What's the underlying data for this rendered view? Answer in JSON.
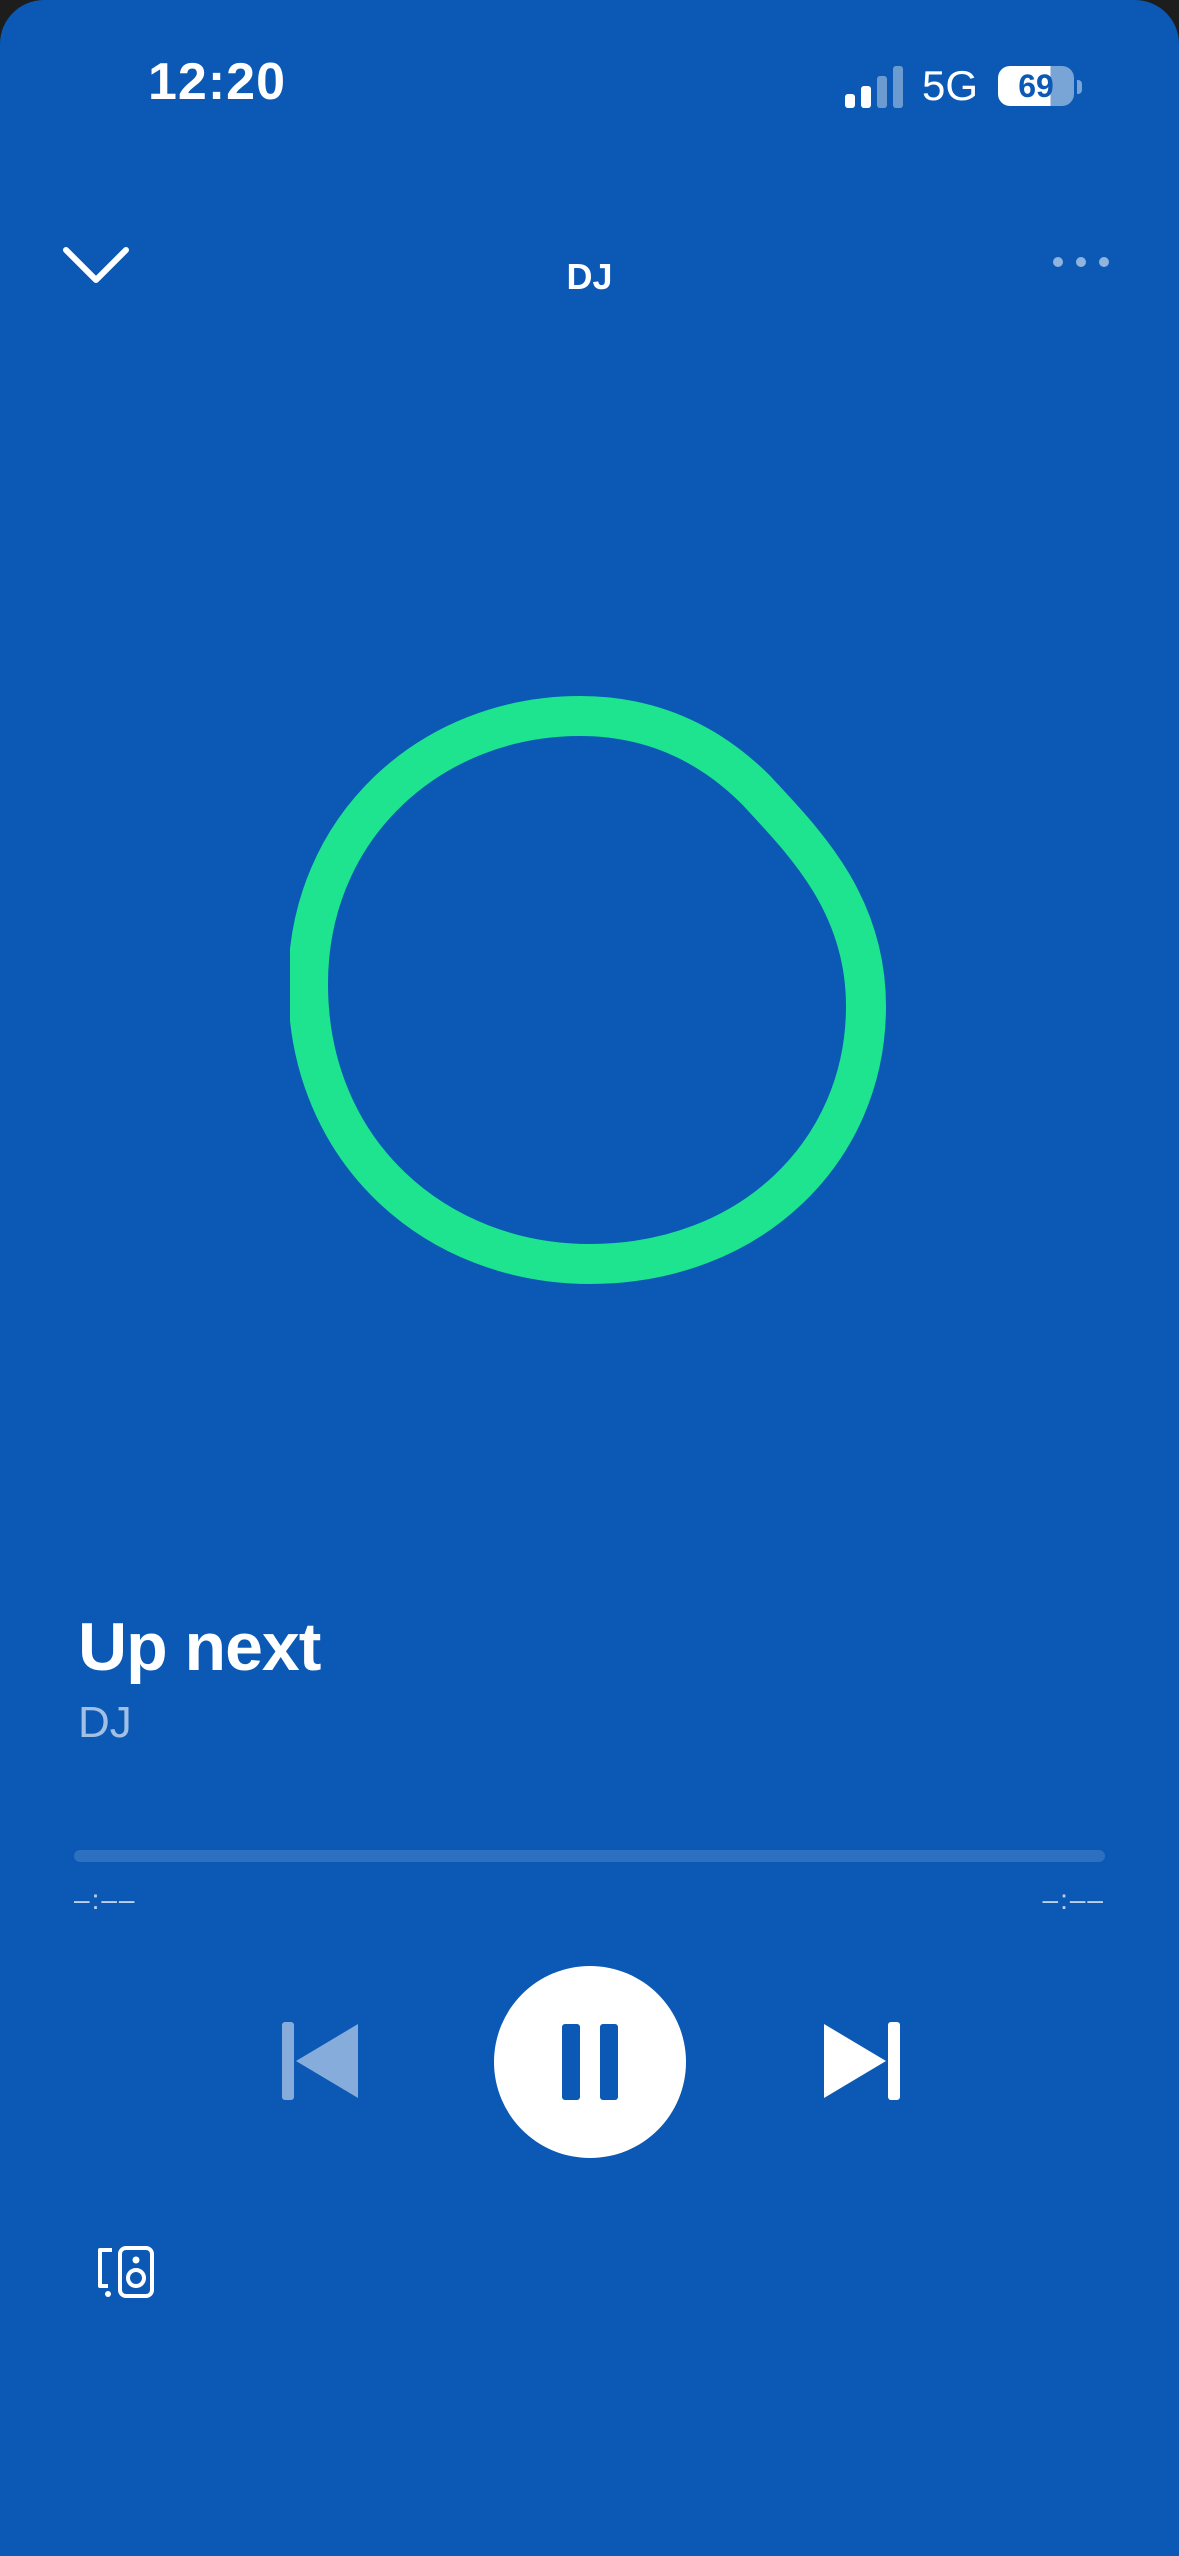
{
  "status_bar": {
    "time": "12:20",
    "network": "5G",
    "battery_level": "69",
    "signal_icon": "cellular-signal-icon"
  },
  "header": {
    "title": "DJ",
    "collapse_icon": "chevron-down-icon",
    "more_icon": "more-options-icon"
  },
  "artwork": {
    "icon": "dj-ring-icon",
    "ring_color": "#1ee38f",
    "background_color": "#0b59b5"
  },
  "track": {
    "title": "Up next",
    "artist": "DJ"
  },
  "progress": {
    "elapsed": "–:––",
    "remaining": "–:––",
    "fraction": 0
  },
  "controls": {
    "previous_icon": "skip-previous-icon",
    "play_pause_icon": "pause-icon",
    "next_icon": "skip-next-icon",
    "previous_enabled": false
  },
  "footer": {
    "devices_icon": "connect-device-icon"
  }
}
